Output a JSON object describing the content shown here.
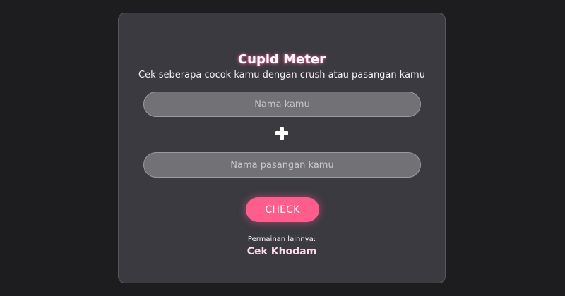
{
  "app": {
    "title": "Cupid Meter",
    "subtitle": "Cek seberapa cocok kamu dengan crush atau pasangan kamu"
  },
  "form": {
    "name_placeholder": "Nama kamu",
    "partner_placeholder": "Nama pasangan kamu",
    "name_value": "",
    "partner_value": "",
    "plus_icon": "plus-icon",
    "check_label": "CHECK"
  },
  "footer": {
    "more_label": "Permainan lainnya:",
    "link_label": "Cek Khodam"
  },
  "colors": {
    "background": "#1d1d1f",
    "card": "#3a3a40",
    "accent": "#ff5d8c",
    "link": "#ffdbe8"
  }
}
